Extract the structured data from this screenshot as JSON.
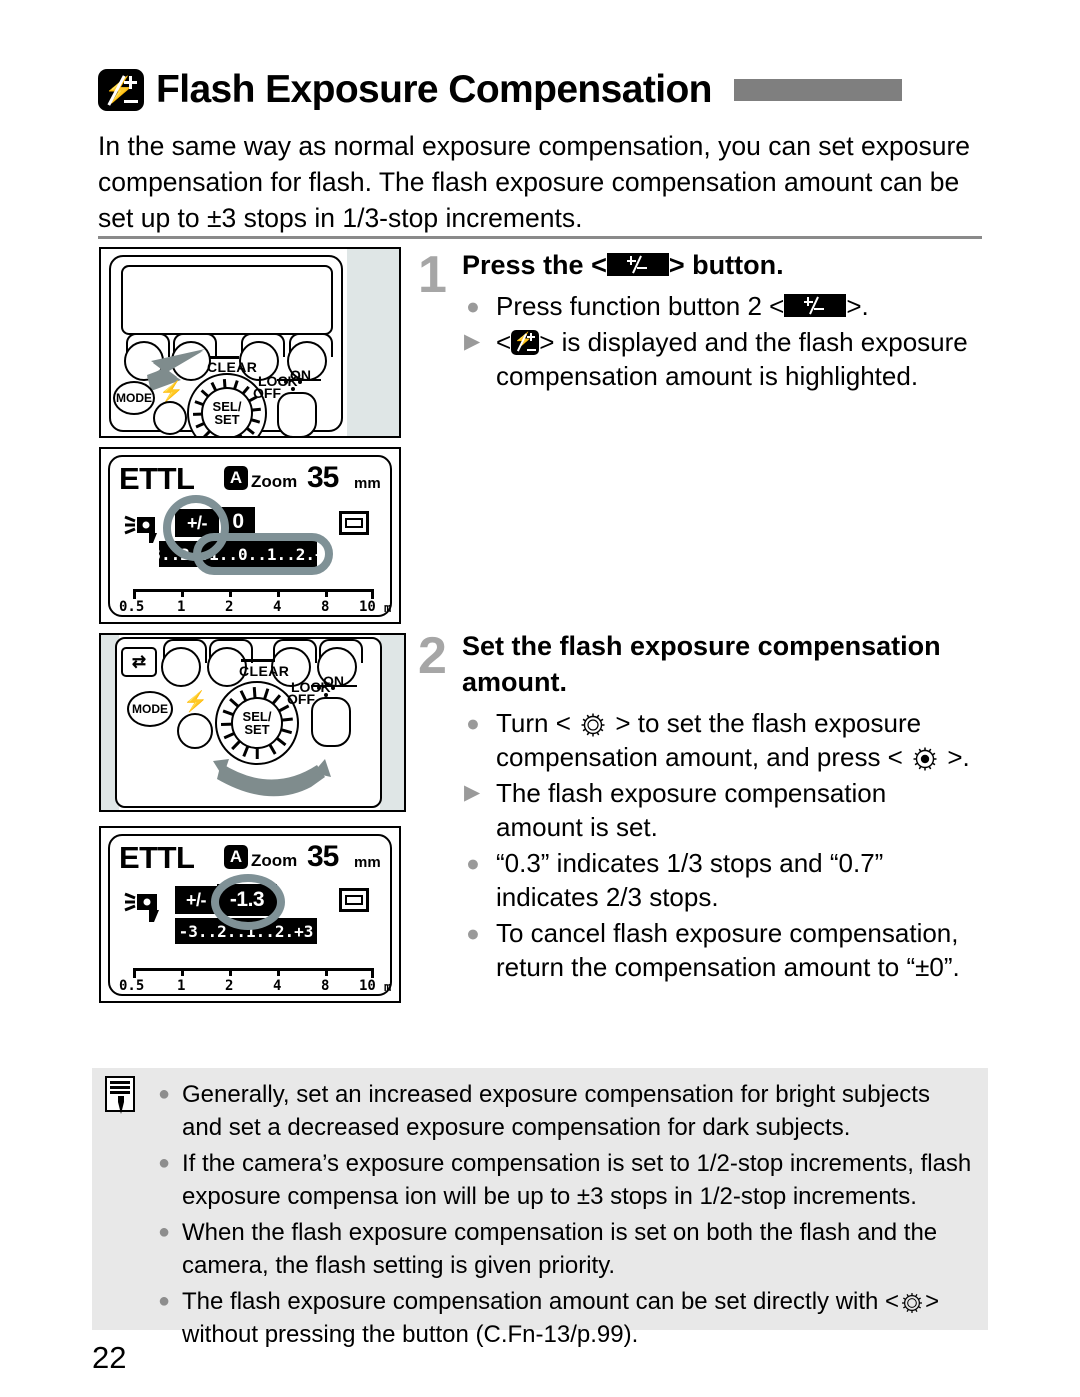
{
  "page": {
    "number": "22",
    "title": "Flash Exposure Compensation",
    "title_icon": "flash-exposure-compensation-icon",
    "intro": "In the same way as normal exposure compensation, you can set exposure compensation for flash. The flash exposure compensation amount can be set up to ±3 stops in 1/3-stop increments."
  },
  "steps": [
    {
      "number": "1",
      "heading_before": "Press the <",
      "heading_after": "> button.",
      "bullets": [
        {
          "marker": "dot",
          "before": "Press function button 2 <",
          "after": ">.",
          "icon": "plus-minus-button-icon"
        },
        {
          "marker": "triangle",
          "before": "<",
          "after": "> is displayed and the flash exposure compensation amount is highlighted.",
          "icon": "flash-exposure-compensation-icon"
        }
      ]
    },
    {
      "number": "2",
      "heading": "Set the flash exposure compensation amount.",
      "bullets": [
        {
          "marker": "dot",
          "parts": [
            "Turn <",
            "select-dial-icon",
            "> to set the flash exposure compensation amount, and press <",
            "set-dial-icon",
            ">."
          ]
        },
        {
          "marker": "triangle",
          "text": "The flash exposure compensation amount is set."
        },
        {
          "marker": "dot",
          "text": "“0.3” indicates 1/3 stops and “0.7” indicates 2/3 stops."
        },
        {
          "marker": "dot",
          "text": "To cancel flash exposure compensation, return the compensation amount to “±0”."
        }
      ]
    }
  ],
  "figures": {
    "flash_panel_1": {
      "name": "flash-rear-panel-press-button",
      "labels": {
        "clear": "CLEAR",
        "lock": "LOCK",
        "on": "ON",
        "off": "OFF",
        "mode": "MODE",
        "selset_1": "SEL/",
        "selset_2": "SET"
      }
    },
    "lcd_1": {
      "name": "lcd-display-before",
      "mode": "ETTL",
      "zoom_mode": "A",
      "zoom_label": "Zoom",
      "focal_length": "35",
      "focal_unit": "mm",
      "fec_label": "+/-",
      "fec_value": "0",
      "scale": "-3..2..1..0..1..2.+3",
      "distance_ticks": [
        "0.5",
        "1",
        "2",
        "4",
        "8",
        "10"
      ],
      "distance_unit": "m"
    },
    "flash_panel_2": {
      "name": "flash-rear-panel-turn-dial",
      "labels": {
        "clear": "CLEAR",
        "lock": "LOCK",
        "on": "ON",
        "off": "OFF",
        "mode": "MODE",
        "selset_1": "SEL/",
        "selset_2": "SET"
      }
    },
    "lcd_2": {
      "name": "lcd-display-after",
      "mode": "ETTL",
      "zoom_mode": "A",
      "zoom_label": "Zoom",
      "focal_length": "35",
      "focal_unit": "mm",
      "fec_label": "+/-",
      "fec_value": "-1.3",
      "scale": "-3..2..1..2.+3",
      "distance_ticks": [
        "0.5",
        "1",
        "2",
        "4",
        "8",
        "10"
      ],
      "distance_unit": "m"
    }
  },
  "note": {
    "icon": "memo-note-icon",
    "items": [
      "Generally, set an increased exposure compensation for bright subjects and set a decreased exposure compensation for dark subjects.",
      "If the camera’s exposure compensation is set to 1/2-stop increments, flash exposure compensa ion will be up to ±3 stops in 1/2-stop increments.",
      "When the flash exposure compensation is set on both the flash and the camera, the flash setting is given priority.",
      "The flash exposure compensation amount can be set directly with <  > without pressing the button (C.Fn-13/p.99)."
    ],
    "item4_before": "The flash exposure compensation amount can be set directly with <",
    "item4_after": "> without pressing the button (C.Fn-13/p.99)."
  },
  "colors": {
    "title_bar": "#7f7f7f",
    "step_number": "#a6a6a6",
    "highlight_ring": "#7f9196",
    "note_bg": "#e8e8e8",
    "arrow": "#7f8c8d"
  }
}
